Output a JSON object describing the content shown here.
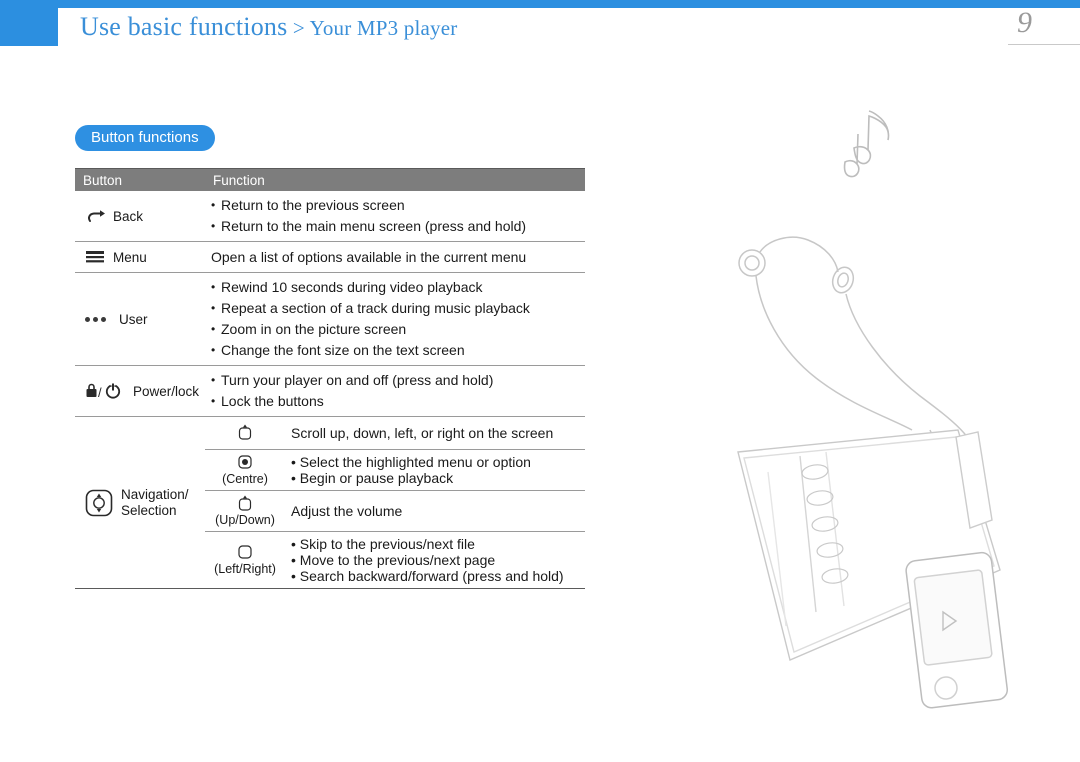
{
  "header": {
    "title_main": "Use basic functions",
    "title_sep": " > ",
    "title_sub": "Your MP3 player",
    "page_number": "9"
  },
  "section": {
    "pill_label": "Button functions"
  },
  "table": {
    "columns": [
      "Button",
      "Function"
    ],
    "rows": [
      {
        "icon": "back-arrow-icon",
        "label": "Back",
        "lines": [
          {
            "bullet": true,
            "text": "Return to the previous screen"
          },
          {
            "bullet": true,
            "text": "Return to the main menu screen (press and hold)"
          }
        ]
      },
      {
        "icon": "menu-lines-icon",
        "label": "Menu",
        "lines": [
          {
            "bullet": false,
            "text": "Open a list of options available in the current menu"
          }
        ]
      },
      {
        "icon": "user-dots-icon",
        "label": "User",
        "lines": [
          {
            "bullet": true,
            "text": "Rewind 10 seconds during video playback"
          },
          {
            "bullet": true,
            "text": "Repeat a section of a track during music playback"
          },
          {
            "bullet": true,
            "text": "Zoom in on the picture screen"
          },
          {
            "bullet": true,
            "text": "Change the font size on the text screen"
          }
        ]
      },
      {
        "icon": "power-lock-icon",
        "label": "Power/lock",
        "lines": [
          {
            "bullet": true,
            "text": "Turn your player on and off (press and hold)"
          },
          {
            "bullet": true,
            "text": "Lock the buttons"
          }
        ]
      }
    ],
    "navigation": {
      "label_line1": "Navigation/",
      "label_line2": "Selection",
      "icon": "navigation-pad-icon",
      "subrows": [
        {
          "icon": "nav-all-directions-icon",
          "caption": "",
          "lines": [
            {
              "bullet": false,
              "text": "Scroll up, down, left, or right on the screen"
            }
          ]
        },
        {
          "icon": "nav-centre-icon",
          "caption": "(Centre)",
          "lines": [
            {
              "bullet": true,
              "text": "Select the highlighted menu or option"
            },
            {
              "bullet": true,
              "text": "Begin or pause playback"
            }
          ]
        },
        {
          "icon": "nav-updown-icon",
          "caption": "(Up/Down)",
          "lines": [
            {
              "bullet": false,
              "text": "Adjust the volume"
            }
          ]
        },
        {
          "icon": "nav-leftright-icon",
          "caption": "(Left/Right)",
          "lines": [
            {
              "bullet": true,
              "text": "Skip to the previous/next file"
            },
            {
              "bullet": true,
              "text": "Move to the previous/next page"
            },
            {
              "bullet": true,
              "text": "Search backward/forward (press and hold)"
            }
          ]
        }
      ]
    }
  },
  "illustration": {
    "music_note_icon": "music-note-icon",
    "earphones_icon": "earphones-icon",
    "organizer_icon": "organizer-notebook-icon",
    "player_icon": "mp3-player-icon",
    "play_icon": "play-triangle-icon"
  },
  "colors": {
    "accent": "#2c8fe0",
    "title": "#3a8fd8",
    "header_row": "#7d7d7d",
    "rule": "#9a9a9a"
  }
}
